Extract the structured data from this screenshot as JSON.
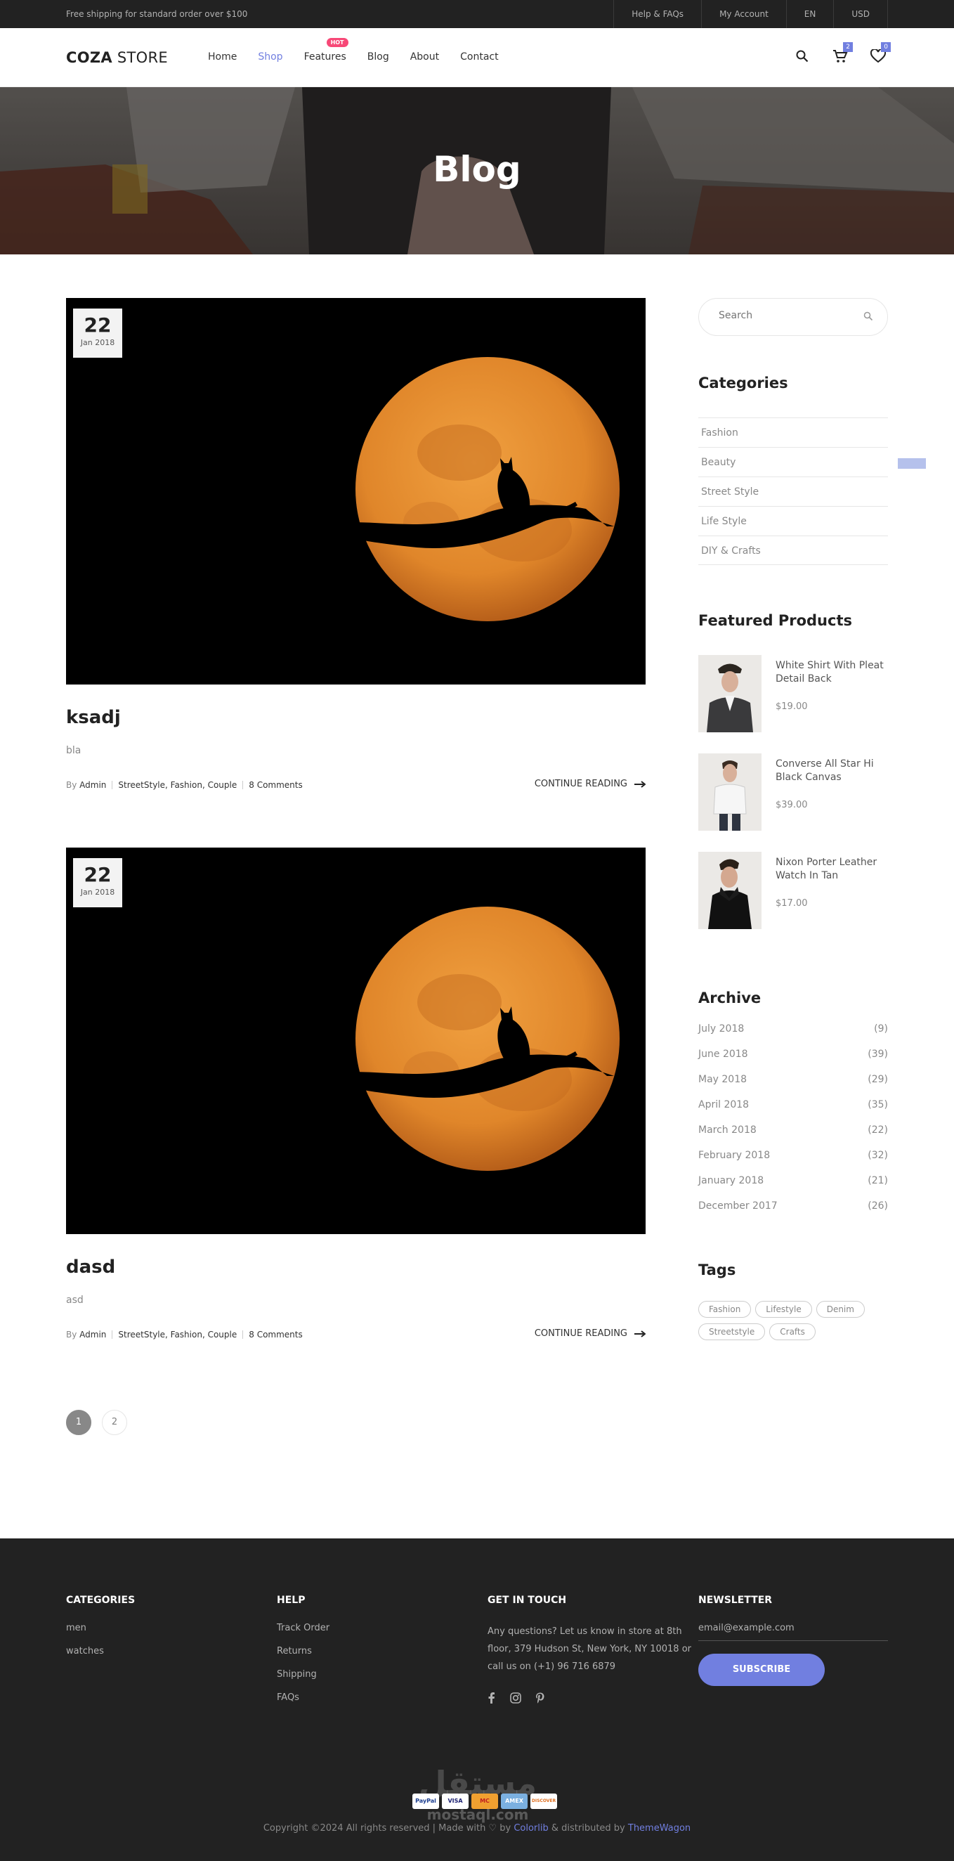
{
  "topbar": {
    "shipping": "Free shipping for standard order over $100",
    "links": [
      "Help & FAQs",
      "My Account",
      "EN",
      "USD"
    ]
  },
  "header": {
    "logo_bold": "COZA",
    "logo_rest": " STORE",
    "nav": [
      "Home",
      "Shop",
      "Features",
      "Blog",
      "About",
      "Contact"
    ],
    "hot_label": "HOT",
    "cart_count": "2",
    "wishlist_count": "0"
  },
  "hero": {
    "title": "Blog"
  },
  "posts": [
    {
      "day": "22",
      "month": "Jan 2018",
      "title": "ksadj",
      "body": "bla",
      "by": "By",
      "author": "Admin",
      "tags": "StreetStyle, Fashion, Couple",
      "comments": "8 Comments",
      "continue": "CONTINUE READING"
    },
    {
      "day": "22",
      "month": "Jan 2018",
      "title": "dasd",
      "body": "asd",
      "by": "By",
      "author": "Admin",
      "tags": "StreetStyle, Fashion, Couple",
      "comments": "8 Comments",
      "continue": "CONTINUE READING"
    }
  ],
  "pagination": [
    "1",
    "2"
  ],
  "sidebar": {
    "search_placeholder": "Search",
    "categories_title": "Categories",
    "categories": [
      "Fashion",
      "Beauty",
      "Street Style",
      "Life Style",
      "DIY & Crafts"
    ],
    "featured_title": "Featured Products",
    "featured": [
      {
        "name": "White Shirt With Pleat Detail Back",
        "price": "$19.00"
      },
      {
        "name": "Converse All Star Hi Black Canvas",
        "price": "$39.00"
      },
      {
        "name": "Nixon Porter Leather Watch In Tan",
        "price": "$17.00"
      }
    ],
    "archive_title": "Archive",
    "archive": [
      {
        "month": "July 2018",
        "count": "(9)"
      },
      {
        "month": "June 2018",
        "count": "(39)"
      },
      {
        "month": "May 2018",
        "count": "(29)"
      },
      {
        "month": "April 2018",
        "count": "(35)"
      },
      {
        "month": "March 2018",
        "count": "(22)"
      },
      {
        "month": "February 2018",
        "count": "(32)"
      },
      {
        "month": "January 2018",
        "count": "(21)"
      },
      {
        "month": "December 2017",
        "count": "(26)"
      }
    ],
    "tags_title": "Tags",
    "tags": [
      "Fashion",
      "Lifestyle",
      "Denim",
      "Streetstyle",
      "Crafts"
    ]
  },
  "footer": {
    "categories_title": "CATEGORIES",
    "categories": [
      "men",
      "watches"
    ],
    "help_title": "HELP",
    "help": [
      "Track Order",
      "Returns",
      "Shipping",
      "FAQs"
    ],
    "touch_title": "GET IN TOUCH",
    "touch_text": "Any questions? Let us know in store at 8th floor, 379 Hudson St, New York, NY 10018 or call us on (+1) 96 716 6879",
    "newsletter_title": "NEWSLETTER",
    "email_placeholder": "email@example.com",
    "subscribe": "SUBSCRIBE",
    "payments": [
      "PayPal",
      "VISA",
      "MC",
      "AMEX",
      "DISCOVER"
    ],
    "watermark": "مستقل",
    "watermark_url": "mostaql.com",
    "copyright": "Copyright ©2024 All rights reserved | Made with ♡ by ",
    "colorlib": "Colorlib",
    "distributed": " & distributed by ",
    "themewagon": "ThemeWagon"
  },
  "colors": {
    "accent": "#717fe0",
    "hot": "#f74877",
    "dark": "#222222",
    "moon": "#e0892a"
  }
}
